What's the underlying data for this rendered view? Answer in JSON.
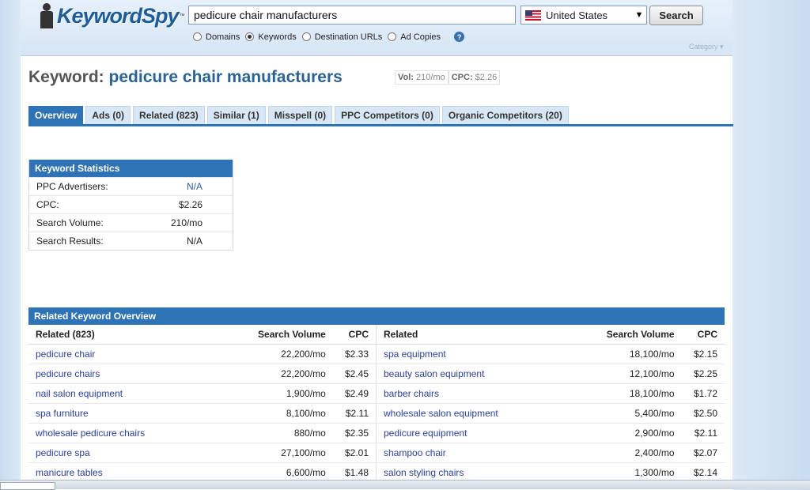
{
  "header": {
    "logo_text": "KeywordSpy",
    "logo_tm": "™",
    "search_value": "pedicure chair manufacturers",
    "country": "United States",
    "search_button": "Search",
    "radio_options": [
      {
        "label": "Domains",
        "checked": false
      },
      {
        "label": "Keywords",
        "checked": true
      },
      {
        "label": "Destination URLs",
        "checked": false
      },
      {
        "label": "Ad Copies",
        "checked": false
      }
    ],
    "help": "?",
    "category": "Category ▾"
  },
  "keyword": {
    "prefix": "Keyword:",
    "term": "pedicure chair manufacturers",
    "vol_label": "Vol:",
    "vol_value": "210/mo",
    "cpc_label": "CPC:",
    "cpc_value": "$2.26"
  },
  "tabs": [
    {
      "label": "Overview",
      "active": true
    },
    {
      "label": "Ads (0)"
    },
    {
      "label": "Related (823)"
    },
    {
      "label": "Similar (1)"
    },
    {
      "label": "Misspell (0)"
    },
    {
      "label": "PPC Competitors (0)"
    },
    {
      "label": "Organic Competitors (20)"
    }
  ],
  "stats": {
    "title": "Keyword Statistics",
    "rows": [
      {
        "label": "PPC Advertisers:",
        "value": "N/A",
        "link": true
      },
      {
        "label": "CPC:",
        "value": "$2.26"
      },
      {
        "label": "Search Volume:",
        "value": "210/mo"
      },
      {
        "label": "Search Results:",
        "value": "N/A"
      }
    ]
  },
  "related": {
    "title": "Related Keyword Overview",
    "left": {
      "headers": [
        "Related (823)",
        "Search Volume",
        "CPC"
      ],
      "rows": [
        [
          "pedicure chair",
          "22,200/mo",
          "$2.33"
        ],
        [
          "pedicure chairs",
          "22,200/mo",
          "$2.45"
        ],
        [
          "nail salon equipment",
          "1,900/mo",
          "$2.49"
        ],
        [
          "spa furniture",
          "8,100/mo",
          "$2.11"
        ],
        [
          "wholesale pedicure chairs",
          "880/mo",
          "$2.35"
        ],
        [
          "pedicure spa",
          "27,100/mo",
          "$2.01"
        ],
        [
          "manicure tables",
          "6,600/mo",
          "$1.48"
        ]
      ]
    },
    "right": {
      "headers": [
        "Related",
        "Search Volume",
        "CPC"
      ],
      "rows": [
        [
          "spa equipment",
          "18,100/mo",
          "$2.15"
        ],
        [
          "beauty salon equipment",
          "12,100/mo",
          "$2.25"
        ],
        [
          "barber chairs",
          "18,100/mo",
          "$1.72"
        ],
        [
          "wholesale salon equipment",
          "5,400/mo",
          "$2.50"
        ],
        [
          "pedicure equipment",
          "2,900/mo",
          "$2.11"
        ],
        [
          "shampoo chair",
          "2,400/mo",
          "$2.07"
        ],
        [
          "salon styling chairs",
          "1,300/mo",
          "$2.14"
        ]
      ]
    }
  }
}
